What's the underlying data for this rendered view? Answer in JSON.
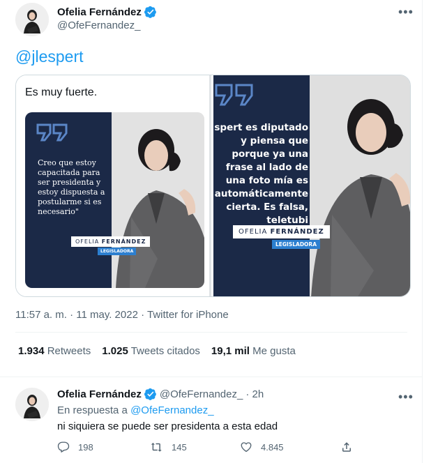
{
  "tweet": {
    "author_name": "Ofelia Fernández",
    "author_handle": "@OfeFernandez_",
    "more_label": "•••",
    "mention_text": "@jlespert",
    "timestamp": "11:57 a. m. · 11 may. 2022 · Twitter for iPhone",
    "stats": [
      {
        "value": "1.934",
        "label": "Retweets"
      },
      {
        "value": "1.025",
        "label": "Tweets citados"
      },
      {
        "value": "19,1 mil",
        "label": "Me gusta"
      }
    ]
  },
  "media": {
    "embedded_text": "Es muy fuerte.",
    "small_card": {
      "quote": "Creo que estoy capacitada para ser presidenta y estoy dispuesta a postularme si es necesario\"",
      "first_name": "OFELIA",
      "last_name": "FERNÁNDEZ",
      "role": "LEGISLADORA"
    },
    "big_card": {
      "quote": "spert es diputado y piensa que porque ya una frase al lado de una foto mía es automáticamente cierta. Es falsa, teletubi",
      "first_name": "OFELIA",
      "last_name": "FERNÁNDEZ",
      "role": "LEGISLADORA"
    }
  },
  "reply": {
    "author_name": "Ofelia Fernández",
    "author_handle": "@OfeFernandez_",
    "time": "· 2h",
    "more_label": "•••",
    "replying_label": "En respuesta a",
    "replying_handle": "@OfeFernandez_",
    "text": "ni siquiera se puede ser presidenta a esta edad",
    "actions": {
      "replies": "198",
      "retweets": "145",
      "likes": "4.845"
    }
  },
  "colors": {
    "accent": "#1d9bf0",
    "navy": "#1b2947",
    "role_badge": "#2c7fd0",
    "secondary_text": "#536471"
  },
  "icons": {
    "verified": "verified-badge-icon",
    "more": "more-icon",
    "reply": "reply-icon",
    "retweet": "retweet-icon",
    "like": "heart-icon",
    "share": "share-icon"
  }
}
